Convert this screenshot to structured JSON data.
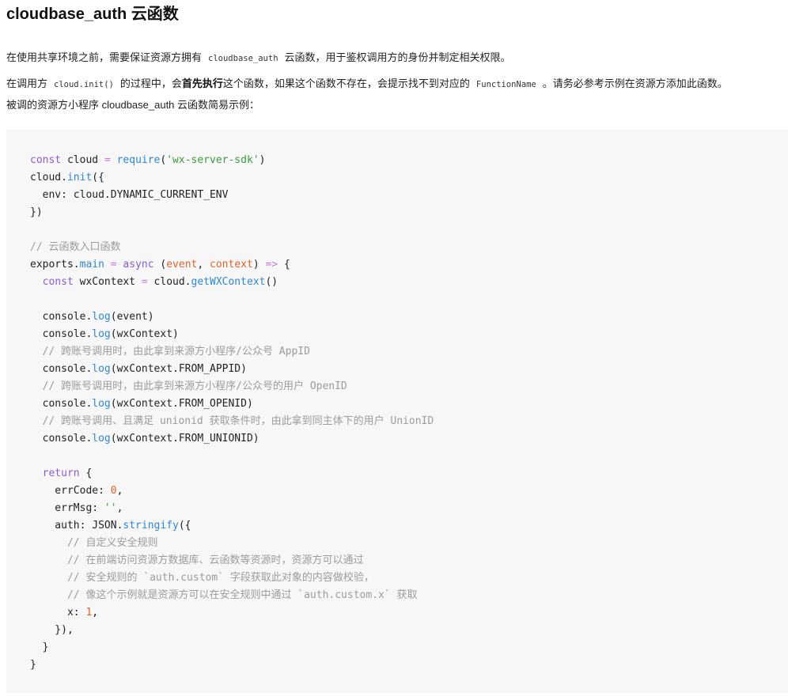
{
  "title": "cloudbase_auth 云函数",
  "para1": {
    "before": "在使用共享环境之前，需要保证资源方拥有",
    "code": "cloudbase_auth",
    "after": "云函数，用于鉴权调用方的身份并制定相关权限。"
  },
  "para2": {
    "a": "在调用方",
    "code1": "cloud.init()",
    "b": "的过程中，会",
    "bold": "首先执行",
    "c": "这个函数，如果这个函数不存在，会提示找不到对应的",
    "code2": "FunctionName",
    "d": "。请务必参考示例在资源方添加此函数。"
  },
  "para3": "被调的资源方小程序 cloudbase_auth 云函数简易示例：",
  "code": {
    "l1_kw": "const",
    "l1_a": " cloud ",
    "l1_op": "=",
    "l1_fn": " require",
    "l1_b": "(",
    "l1_str": "'wx-server-sdk'",
    "l1_c": ")",
    "l2_a": "cloud.",
    "l2_fn": "init",
    "l2_b": "({",
    "l3": "  env: cloud.DYNAMIC_CURRENT_ENV",
    "l4": "})",
    "l6": "// 云函数入口函数",
    "l7_a": "exports.",
    "l7_fn": "main",
    "l7_op": " = ",
    "l7_kw": "async",
    "l7_b": " (",
    "l7_p1": "event",
    "l7_c": ", ",
    "l7_p2": "context",
    "l7_d": ") ",
    "l7_arrow": "=>",
    "l7_e": " {",
    "l8_kw": "  const",
    "l8_a": " wxContext ",
    "l8_op": "=",
    "l8_b": " cloud.",
    "l8_fn": "getWXContext",
    "l8_c": "()",
    "l10_a": "  console.",
    "l10_fn": "log",
    "l10_b": "(event)",
    "l11_a": "  console.",
    "l11_fn": "log",
    "l11_b": "(wxContext)",
    "l12": "  // 跨账号调用时，由此拿到来源方小程序/公众号 AppID",
    "l13_a": "  console.",
    "l13_fn": "log",
    "l13_b": "(wxContext.FROM_APPID)",
    "l14": "  // 跨账号调用时，由此拿到来源方小程序/公众号的用户 OpenID",
    "l15_a": "  console.",
    "l15_fn": "log",
    "l15_b": "(wxContext.FROM_OPENID)",
    "l16": "  // 跨账号调用、且满足 unionid 获取条件时，由此拿到同主体下的用户 UnionID",
    "l17_a": "  console.",
    "l17_fn": "log",
    "l17_b": "(wxContext.FROM_UNIONID)",
    "l19_kw": "  return",
    "l19_a": " {",
    "l20_a": "    errCode: ",
    "l20_num": "0",
    "l20_b": ",",
    "l21_a": "    errMsg: ",
    "l21_str": "''",
    "l21_b": ",",
    "l22_a": "    auth: JSON.",
    "l22_fn": "stringify",
    "l22_b": "({",
    "l23": "      // 自定义安全规则",
    "l24": "      // 在前端访问资源方数据库、云函数等资源时，资源方可以通过",
    "l25": "      // 安全规则的 `auth.custom` 字段获取此对象的内容做校验，",
    "l26": "      // 像这个示例就是资源方可以在安全规则中通过 `auth.custom.x` 获取",
    "l27_a": "      x: ",
    "l27_num": "1",
    "l27_b": ",",
    "l28": "    }),",
    "l29": "  }",
    "l30": "}"
  }
}
